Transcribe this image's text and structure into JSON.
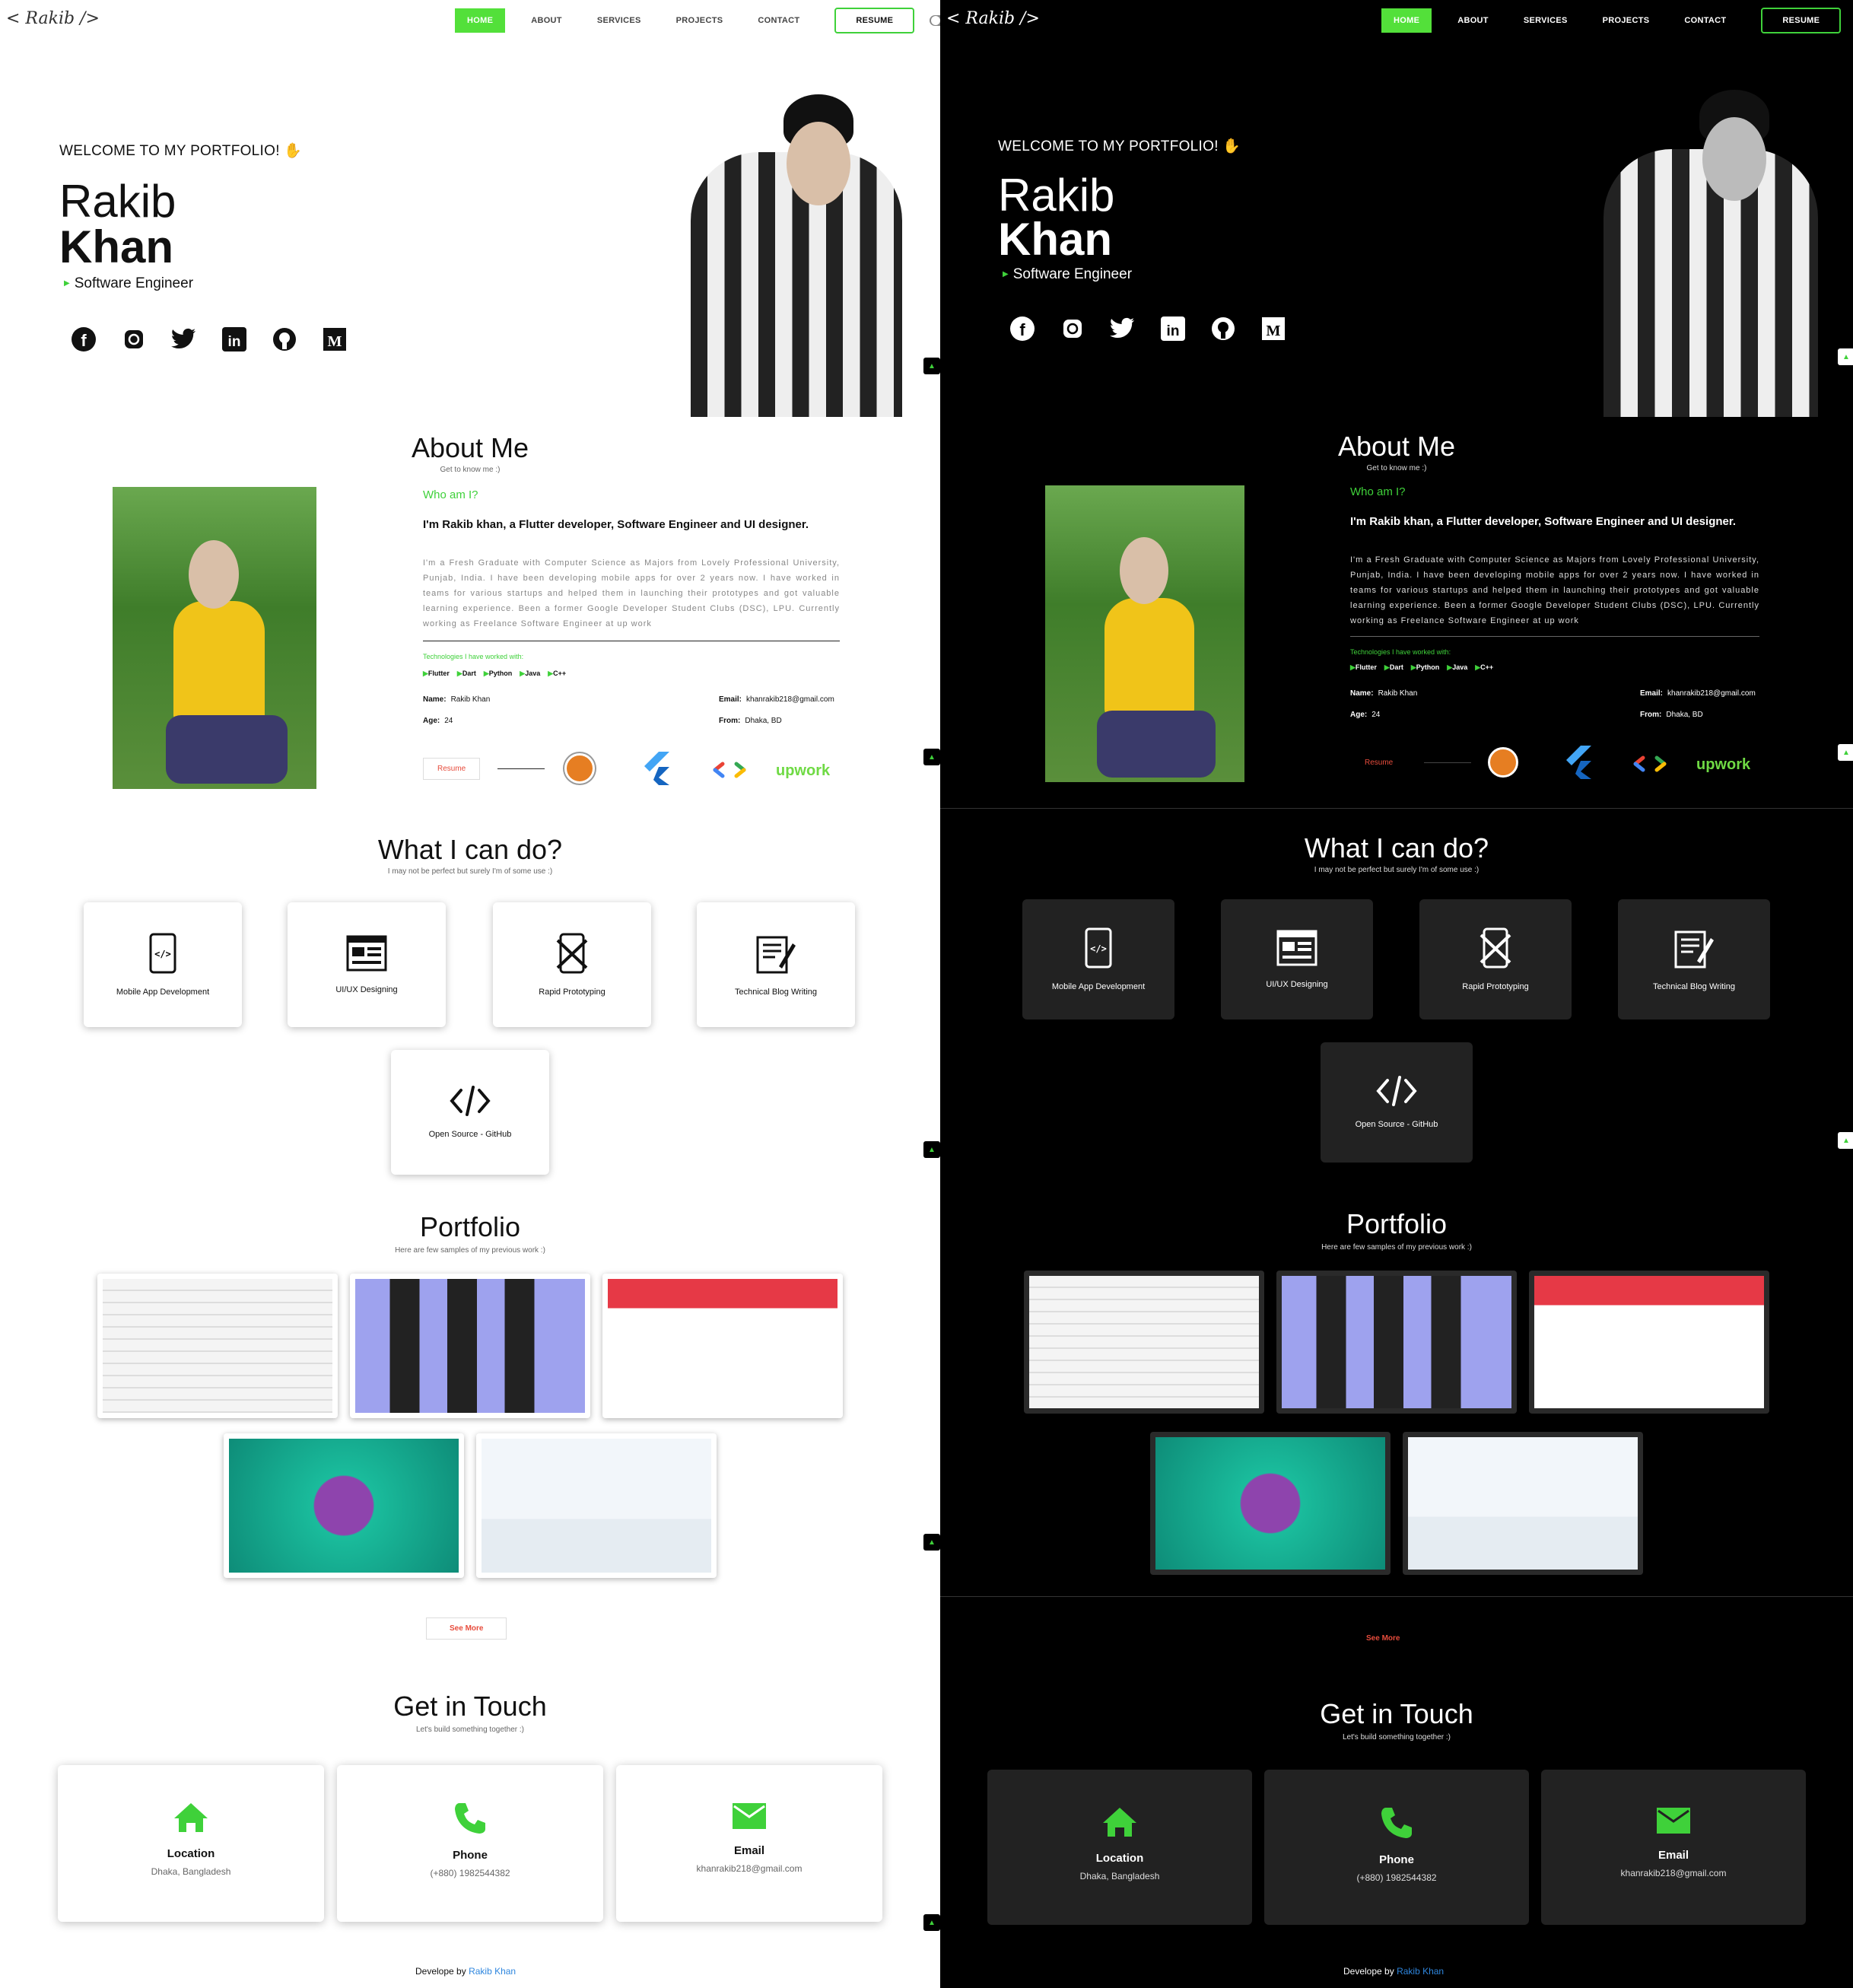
{
  "brand": {
    "logo": "< Rakib />"
  },
  "nav": {
    "home": "HOME",
    "about": "ABOUT",
    "services": "SERVICES",
    "projects": "PROJECTS",
    "contact": "CONTACT",
    "resume": "RESUME"
  },
  "hero": {
    "welcome": "WELCOME TO MY PORTFOLIO!",
    "first_name": "Rakib",
    "last_name": "Khan",
    "role": "Software Engineer"
  },
  "social": [
    "facebook-icon",
    "instagram-icon",
    "twitter-icon",
    "linkedin-icon",
    "github-icon",
    "medium-icon"
  ],
  "about": {
    "title": "About Me",
    "subtitle": "Get to know me :)",
    "who": "Who am I?",
    "headline": "I'm Rakib khan, a Flutter developer, Software Engineer and UI designer.",
    "bio": "I'm a Fresh Graduate with Computer Science as Majors from Lovely Professional University, Punjab, India. I have been developing mobile apps for over 2 years now. I have worked in teams for various startups and helped them in launching their prototypes and got valuable learning experience. Been a former  Google Developer Student Clubs (DSC), LPU. Currently working as Freelance Software Engineer at up work",
    "tech_title": "Technologies I have worked with:",
    "techs": [
      "Flutter",
      "Dart",
      "Python",
      "Java",
      "C++"
    ],
    "name_label": "Name:",
    "name": "Rakib Khan",
    "email_label": "Email:",
    "email": "khanrakib218@gmail.com",
    "age_label": "Age:",
    "age": "24",
    "from_label": "From:",
    "from": "Dhaka, BD",
    "resume": "Resume",
    "upwork": "upwork"
  },
  "services": {
    "title": "What I can do?",
    "subtitle": "I may not be perfect but surely I'm of some use :)",
    "items": [
      "Mobile App Development",
      "UI/UX Designing",
      "Rapid Prototyping",
      "Technical Blog Writing",
      "Open Source - GitHub"
    ]
  },
  "portfolio": {
    "title": "Portfolio",
    "subtitle": "Here are few samples of my previous work :)",
    "see_more": "See More"
  },
  "contact": {
    "title": "Get in Touch",
    "subtitle": "Let's build something together :)",
    "location_label": "Location",
    "location": "Dhaka, Bangladesh",
    "phone_label": "Phone",
    "phone": "(+880) 1982544382",
    "email_label": "Email",
    "email": "khanrakib218@gmail.com"
  },
  "footer": {
    "prefix": "Develope by",
    "author": "Rakib Khan"
  },
  "colors": {
    "accent": "#53e03a",
    "link": "#2e86de",
    "resume_red": "#e74c3c"
  }
}
